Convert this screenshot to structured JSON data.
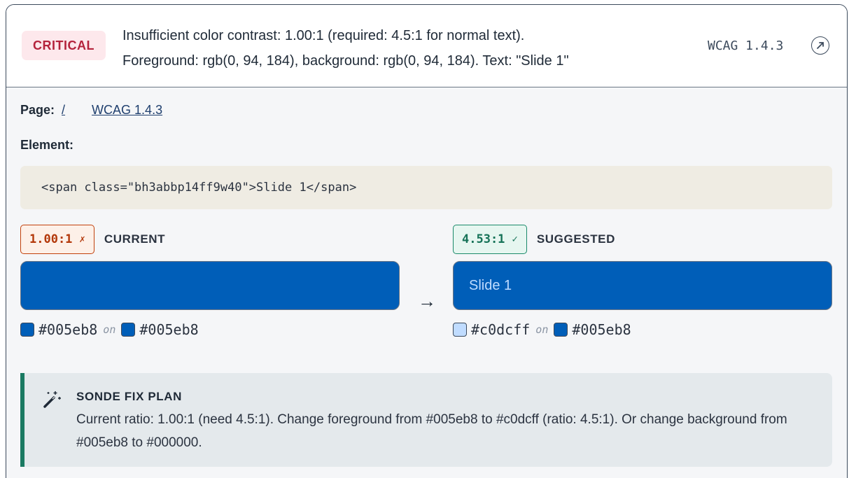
{
  "issue": {
    "severity": "CRITICAL",
    "message_line1": "Insufficient color contrast: 1.00:1 (required: 4.5:1 for normal text).",
    "message_line2": "Foreground: rgb(0, 94, 184), background: rgb(0, 94, 184). Text: \"Slide 1\"",
    "wcag_ref": "WCAG 1.4.3"
  },
  "details": {
    "page_label": "Page:",
    "page_path": "/",
    "wcag_link": "WCAG 1.4.3",
    "element_label": "Element:",
    "element_code": "<span class=\"bh3abbp14ff9w40\">Slide 1</span>"
  },
  "current": {
    "ratio": "1.00:1",
    "mark": "✗",
    "label": "CURRENT",
    "sample_text": "",
    "foreground": "#005eb8",
    "background": "#005eb8",
    "on_word": "on"
  },
  "suggested": {
    "ratio": "4.53:1",
    "mark": "✓",
    "label": "SUGGESTED",
    "sample_text": "Slide 1",
    "foreground": "#c0dcff",
    "background": "#005eb8",
    "on_word": "on"
  },
  "arrow": "→",
  "fix_plan": {
    "title": "SONDE FIX PLAN",
    "text": "Current ratio: 1.00:1 (need 4.5:1). Change foreground from #005eb8 to #c0dcff (ratio: 4.5:1). Or change background from #005eb8 to #000000.",
    "icon": "magic-wand-icon"
  },
  "colors": {
    "critical": "#b4233c",
    "fail": "#c2410c",
    "pass": "#1a8a6a",
    "accent": "#1a7a62"
  }
}
